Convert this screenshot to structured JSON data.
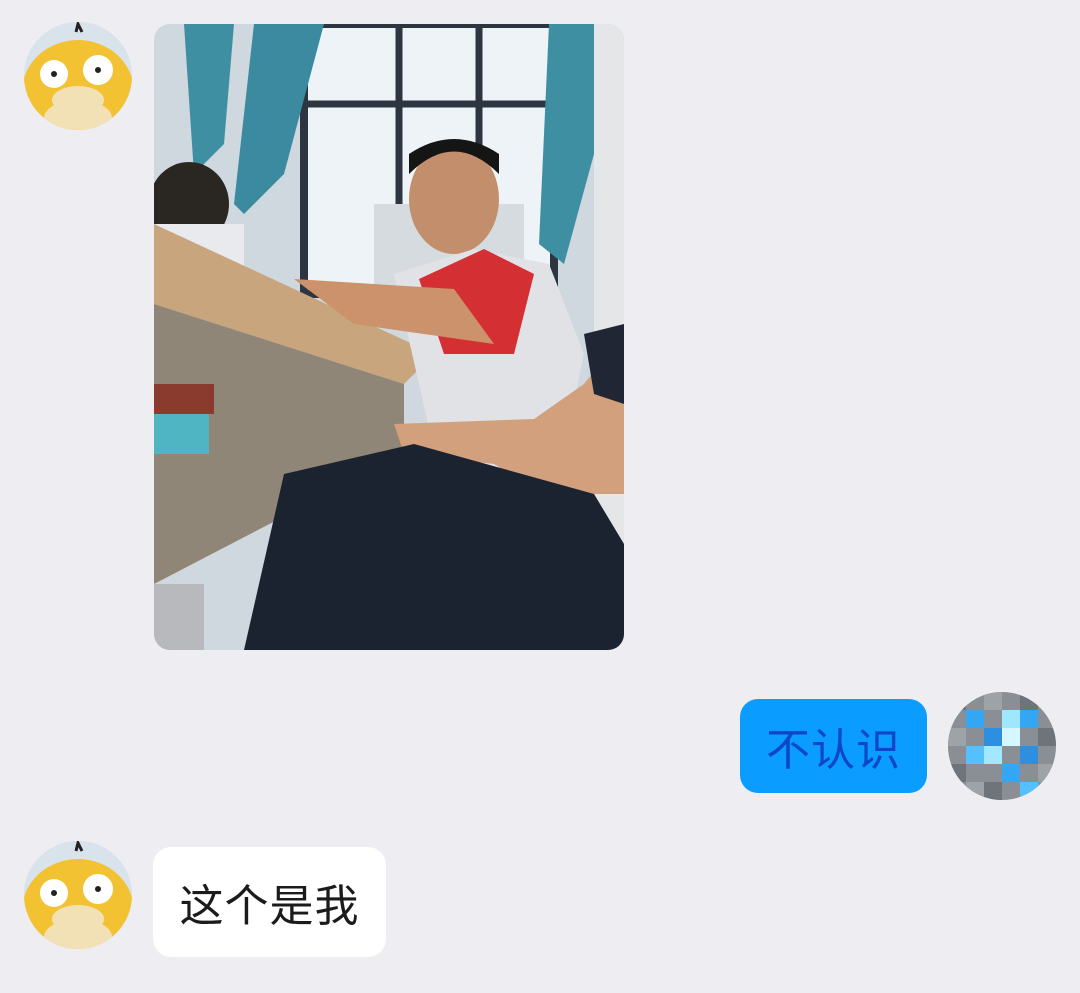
{
  "chat": {
    "messages": [
      {
        "sender": "friend",
        "type": "image",
        "avatar_icon": "psyduck-avatar-icon",
        "image_alt": "classroom-photo"
      },
      {
        "sender": "me",
        "type": "text",
        "text": "不认识",
        "avatar_icon": "pixel-ore-avatar-icon"
      },
      {
        "sender": "friend",
        "type": "text",
        "text": "这个是我",
        "avatar_icon": "psyduck-avatar-icon"
      }
    ]
  },
  "colors": {
    "background": "#ededf2",
    "sent_bubble": "#0a9cff",
    "sent_text": "#0b47c9",
    "received_bubble": "#ffffff"
  }
}
